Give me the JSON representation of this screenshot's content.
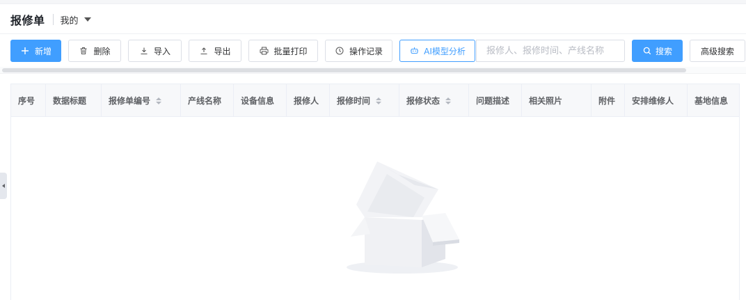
{
  "header": {
    "title": "报修单",
    "view_label": "我的"
  },
  "toolbar": {
    "add_label": "新增",
    "delete_label": "删除",
    "import_label": "导入",
    "export_label": "导出",
    "batch_print_label": "批量打印",
    "history_label": "操作记录",
    "ai_label": "AI模型分析",
    "search_placeholder": "报修人、报修时间、产线名称",
    "search_label": "搜索",
    "advanced_search_label": "高级搜索"
  },
  "table": {
    "columns": [
      {
        "label": "序号",
        "sortable": false
      },
      {
        "label": "数据标题",
        "sortable": false
      },
      {
        "label": "报修单编号",
        "sortable": true
      },
      {
        "label": "产线名称",
        "sortable": false
      },
      {
        "label": "设备信息",
        "sortable": false
      },
      {
        "label": "报修人",
        "sortable": false
      },
      {
        "label": "报修时间",
        "sortable": true
      },
      {
        "label": "报修状态",
        "sortable": true
      },
      {
        "label": "问题描述",
        "sortable": false
      },
      {
        "label": "相关照片",
        "sortable": false
      },
      {
        "label": "附件",
        "sortable": false
      },
      {
        "label": "安排维修人",
        "sortable": false
      },
      {
        "label": "基地信息",
        "sortable": false
      }
    ],
    "rows": []
  },
  "colors": {
    "primary": "#409eff",
    "border": "#dcdfe6",
    "header_bg": "#f7f8fa"
  },
  "icons": {
    "add": "plus-icon",
    "delete": "trash-icon",
    "import": "download-icon",
    "export": "upload-icon",
    "print": "printer-icon",
    "history": "clock-icon",
    "ai": "robot-icon",
    "search": "search-icon",
    "view_dropdown": "caret-down-icon",
    "side_toggle": "caret-left-icon"
  }
}
